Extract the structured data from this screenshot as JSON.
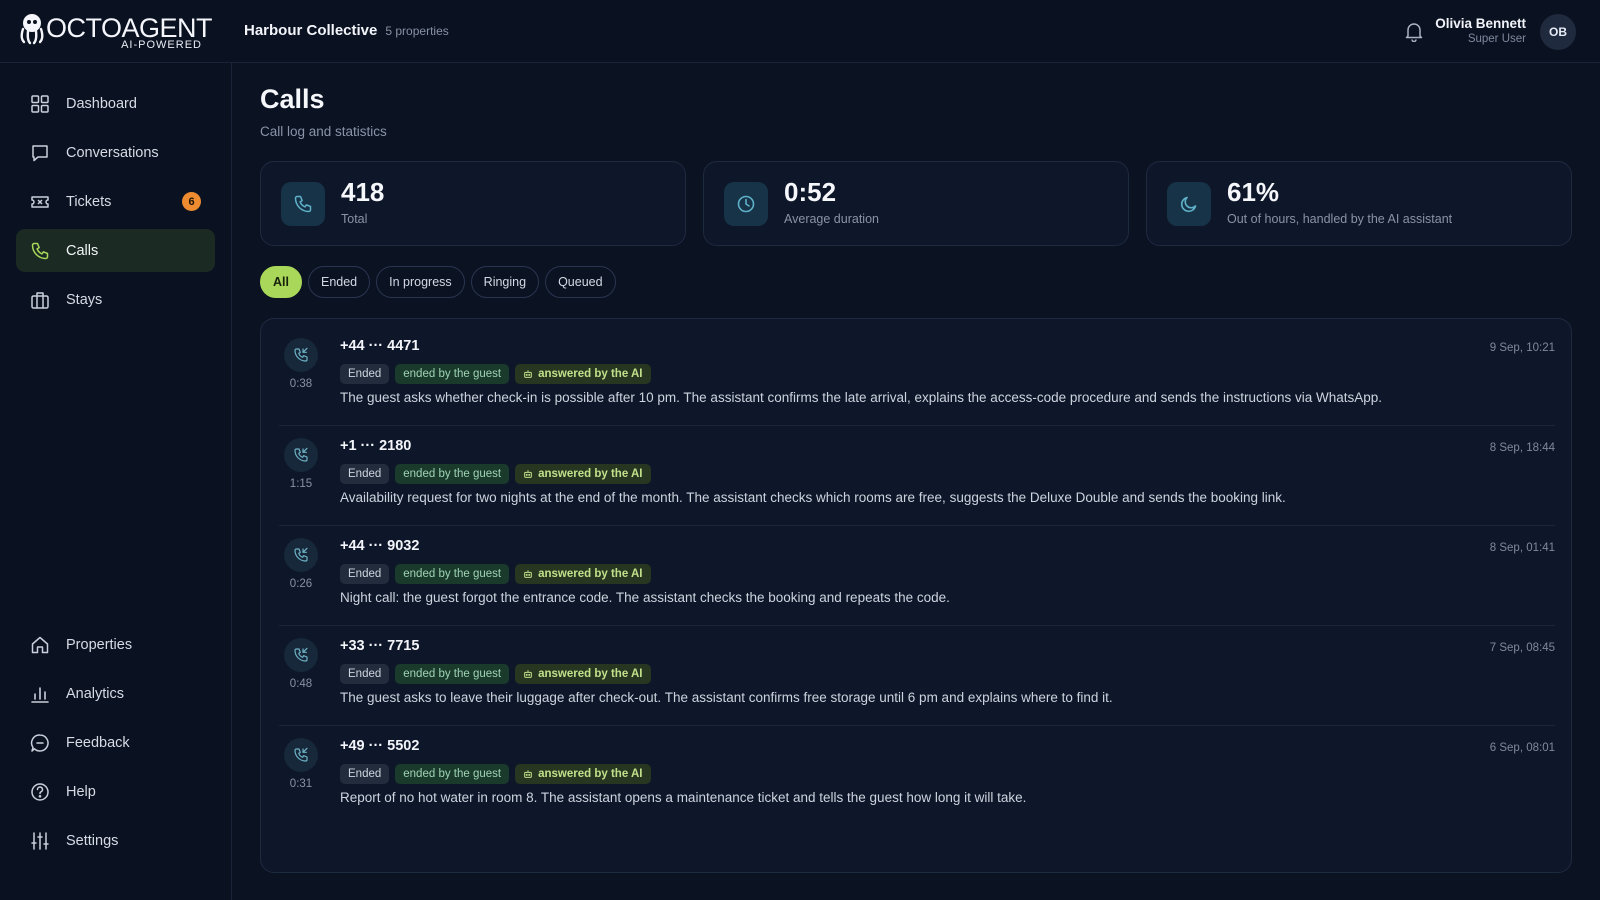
{
  "header": {
    "logo_text": "OCTOAGENT",
    "logo_sub": "AI-POWERED",
    "org_name": "Harbour Collective",
    "org_count": "5 properties",
    "user_name": "Olivia Bennett",
    "user_role": "Super User",
    "avatar_initials": "OB"
  },
  "sidebar": {
    "items": [
      {
        "label": "Dashboard",
        "icon": "grid-icon"
      },
      {
        "label": "Conversations",
        "icon": "chat-icon"
      },
      {
        "label": "Tickets",
        "icon": "ticket-icon",
        "badge": "6"
      },
      {
        "label": "Calls",
        "icon": "phone-icon",
        "active": true
      },
      {
        "label": "Stays",
        "icon": "suitcase-icon"
      }
    ],
    "bottom_items": [
      {
        "label": "Properties",
        "icon": "home-icon"
      },
      {
        "label": "Analytics",
        "icon": "bar-chart-icon"
      },
      {
        "label": "Feedback",
        "icon": "feedback-icon"
      },
      {
        "label": "Help",
        "icon": "help-icon"
      },
      {
        "label": "Settings",
        "icon": "sliders-icon"
      }
    ]
  },
  "page": {
    "title": "Calls",
    "subtitle": "Call log and statistics"
  },
  "stats": [
    {
      "value": "418",
      "label": "Total",
      "icon": "phone-icon"
    },
    {
      "value": "0:52",
      "label": "Average duration",
      "icon": "clock-icon"
    },
    {
      "value": "61%",
      "label": "Out of hours, handled by the AI assistant",
      "icon": "moon-icon"
    }
  ],
  "filters": [
    "All",
    "Ended",
    "In progress",
    "Ringing",
    "Queued"
  ],
  "active_filter": "All",
  "calls": [
    {
      "number": "+44 ··· 4471",
      "duration": "0:38",
      "date": "9 Sep, 10:21",
      "status": "Ended",
      "ended_by": "ended by the guest",
      "answered": "answered by the AI",
      "desc": "The guest asks whether check-in is possible after 10 pm. The assistant confirms the late arrival, explains the access-code procedure and sends the instructions via WhatsApp."
    },
    {
      "number": "+1 ··· 2180",
      "duration": "1:15",
      "date": "8 Sep, 18:44",
      "status": "Ended",
      "ended_by": "ended by the guest",
      "answered": "answered by the AI",
      "desc": "Availability request for two nights at the end of the month. The assistant checks which rooms are free, suggests the Deluxe Double and sends the booking link."
    },
    {
      "number": "+44 ··· 9032",
      "duration": "0:26",
      "date": "8 Sep, 01:41",
      "status": "Ended",
      "ended_by": "ended by the guest",
      "answered": "answered by the AI",
      "desc": "Night call: the guest forgot the entrance code. The assistant checks the booking and repeats the code."
    },
    {
      "number": "+33 ··· 7715",
      "duration": "0:48",
      "date": "7 Sep, 08:45",
      "status": "Ended",
      "ended_by": "ended by the guest",
      "answered": "answered by the AI",
      "desc": "The guest asks to leave their luggage after check-out. The assistant confirms free storage until 6 pm and explains where to find it."
    },
    {
      "number": "+49 ··· 5502",
      "duration": "0:31",
      "date": "6 Sep, 08:01",
      "status": "Ended",
      "ended_by": "ended by the guest",
      "answered": "answered by the AI",
      "desc": "Report of no hot water in room 8. The assistant opens a maintenance ticket and tells the guest how long it will take."
    }
  ],
  "colors": {
    "background": "#0b1222",
    "accent": "#a8d75a",
    "badge": "#ec8b2f"
  }
}
